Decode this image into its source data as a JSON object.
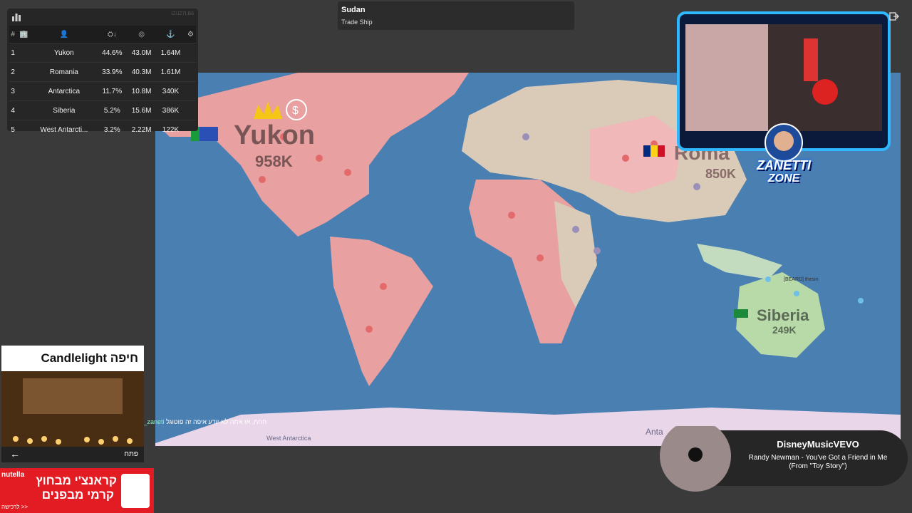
{
  "leaderboard": {
    "game_id": "IZUZ7LB6",
    "headers": [
      "#",
      "🏢",
      "👤",
      "⛭↓",
      "◎",
      "⚓",
      "⚙"
    ],
    "rows": [
      {
        "rank": "1",
        "name": "Yukon",
        "pct": "44.6%",
        "gold": "43.0M",
        "troops": "1.64M"
      },
      {
        "rank": "2",
        "name": "Romania",
        "pct": "33.9%",
        "gold": "40.3M",
        "troops": "1.61M"
      },
      {
        "rank": "3",
        "name": "Antarctica",
        "pct": "11.7%",
        "gold": "10.8M",
        "troops": "340K"
      },
      {
        "rank": "4",
        "name": "Siberia",
        "pct": "5.2%",
        "gold": "15.6M",
        "troops": "386K"
      },
      {
        "rank": "5",
        "name": "West Antarcti...",
        "pct": "3.2%",
        "gold": "2.22M",
        "troops": "122K"
      }
    ]
  },
  "info": {
    "title": "Sudan",
    "subtitle": "Trade Ship"
  },
  "map": {
    "labels": [
      {
        "name": "Yukon",
        "troops": "958K"
      },
      {
        "name": "Roma",
        "troops": "850K"
      },
      {
        "name": "Siberia",
        "troops": "249K"
      },
      {
        "name": "West Antarctica"
      },
      {
        "name": "Anta"
      }
    ],
    "player_tag": "[BEARD] thesin",
    "colors": {
      "ocean": "#4a7fb2",
      "yukon": "#e8a0a0",
      "neutral": "#d9cbb7",
      "siberia": "#b8d9a8",
      "romania": "#f0b8b8"
    }
  },
  "webcam": {
    "logo_top": "ZANETTI",
    "logo_bottom": "ZONE"
  },
  "ad1": {
    "title": "Candlelight חיפה",
    "open": "פתח"
  },
  "ad2": {
    "line1": "קראנצ'י מבחוץ",
    "line2": "קרמי מבפנים",
    "cta": "לרכישה >>",
    "brand": "nutella"
  },
  "chat": {
    "user": "Haetyopit_shell_zaneti",
    "text": "חחח, אז אתה לא יודע איפה זה פוטוגל"
  },
  "music": {
    "channel": "DisneyMusicVEVO",
    "song": "Randy Newman - You've Got a Friend in Me (From \"Toy Story\")"
  }
}
